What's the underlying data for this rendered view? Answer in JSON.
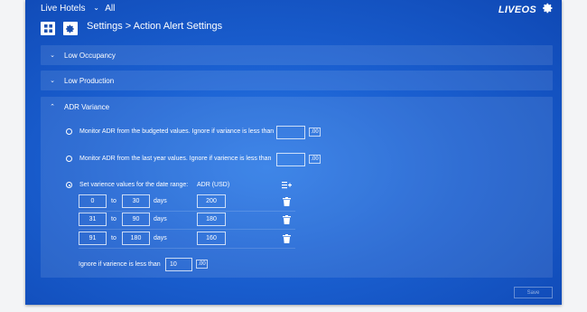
{
  "header": {
    "hotel_name": "Live Hotels",
    "scope": "All",
    "logo_text": "LIVEOS",
    "breadcrumb": "Settings > Action Alert Settings"
  },
  "sections": [
    {
      "label": "Low Occupancy",
      "expanded": false
    },
    {
      "label": "Low Production",
      "expanded": false
    },
    {
      "label": "ADR Variance",
      "expanded": true
    }
  ],
  "adr": {
    "option1": {
      "label": "Monitor ADR from the budgeted values. Ignore if variance is less than",
      "value": "",
      "suffix": ".00",
      "selected": false
    },
    "option2": {
      "label": "Monitor ADR from the last year values. Ignore if varience is less than",
      "value": "",
      "suffix": ".00",
      "selected": false
    },
    "option3": {
      "label": "Set varience values for the date range:",
      "selected": true
    },
    "adr_header": "ADR (USD)",
    "rows": [
      {
        "from": "0",
        "to_word": "to",
        "to": "30",
        "unit": "days",
        "adr": "200"
      },
      {
        "from": "31",
        "to_word": "to",
        "to": "90",
        "unit": "days",
        "adr": "180"
      },
      {
        "from": "91",
        "to_word": "to",
        "to": "180",
        "unit": "days",
        "adr": "160"
      }
    ],
    "ignore_label": "Ignore if varience is less than",
    "ignore_value": "10",
    "ignore_suffix": ".00"
  },
  "footer": {
    "save_label": "Save"
  }
}
